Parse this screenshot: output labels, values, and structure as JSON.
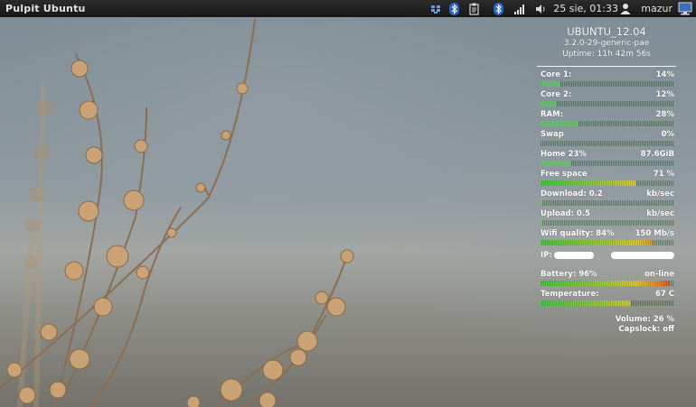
{
  "panel": {
    "title": "Pulpit Ubuntu",
    "clock": "25 sie, 01:33",
    "user": "mazur",
    "tray_icons": [
      "dropbox-icon",
      "bluetooth-icon",
      "clipboard-icon",
      "bluetooth-icon",
      "signal-bars-icon",
      "volume-icon",
      "user-icon",
      "display-icon"
    ]
  },
  "conky": {
    "hostname": "UBUNTU_12.04",
    "kernel": "3.2.0-29-generic-pae",
    "uptime": "Uptime: 11h 42m 56s",
    "rows": [
      {
        "label": "Core 1:",
        "value": "14%",
        "fill": 0.14
      },
      {
        "label": "Core 2:",
        "value": "12%",
        "fill": 0.12
      },
      {
        "label": "RAM:",
        "value": "28%",
        "fill": 0.28
      },
      {
        "label": "Swap",
        "value": "0%",
        "fill": 0.0
      },
      {
        "label": "Home  23%",
        "value": "87.6GiB",
        "fill": 0.23
      },
      {
        "label": "Free space",
        "value": "71 %",
        "fill": 0.71
      },
      {
        "label": "Download: 0.2",
        "value": "kb/sec",
        "fill": 0.01
      },
      {
        "label": "Upload: 0.5",
        "value": "kb/sec",
        "fill": 0.01
      },
      {
        "label": "Wifi quality: 84%",
        "value": "150 Mb/s",
        "fill": 0.84
      }
    ],
    "ip_label": "IP:",
    "rows2": [
      {
        "label": "Battery: 96%",
        "value": "on-line",
        "fill": 0.96
      },
      {
        "label": "Temperature:",
        "value": "67 C",
        "fill": 0.67
      }
    ],
    "volume": "Volume:  26 %",
    "capslock": "Capslock:  off"
  },
  "colors": {
    "panel_bg": "#1e1e1e",
    "bar_green": "#4ad64a",
    "bar_hot": "#e64020"
  }
}
